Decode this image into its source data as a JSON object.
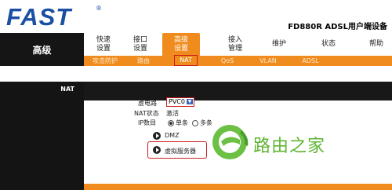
{
  "brand": {
    "name": "FAST",
    "registered": "®",
    "model": "FD880R ADSL用户端设备"
  },
  "nav": {
    "section": "高级",
    "items": [
      {
        "label": "快速\n设置"
      },
      {
        "label": "接口\n设置"
      },
      {
        "label": "高级\n设置"
      },
      {
        "label": "接入\n管理"
      },
      {
        "label": "维护"
      },
      {
        "label": "状态"
      },
      {
        "label": "帮助"
      }
    ],
    "active_index": 2
  },
  "subnav": {
    "items": [
      "攻击防护",
      "路由",
      "NAT",
      "QoS",
      "VLAN",
      "ADSL"
    ],
    "active_index": 2
  },
  "panel": {
    "title": "NAT"
  },
  "form": {
    "pvc_label": "虚电路",
    "pvc_value": "PVC0",
    "nat_status_label": "NAT状态",
    "nat_status_value": "激活",
    "ip_count_label": "IP数目",
    "radio_single": "单条",
    "radio_multi": "多条",
    "dmz_label": "DMZ",
    "virtual_server_label": "虚拟服务器"
  },
  "watermark": {
    "text": "路由之家"
  },
  "colors": {
    "accent_orange": "#f08c1e",
    "brand_blue": "#1a4fa3",
    "dark_band": "#151515",
    "highlight_red": "#cc1c1c",
    "watermark_green": "#5fb432"
  }
}
